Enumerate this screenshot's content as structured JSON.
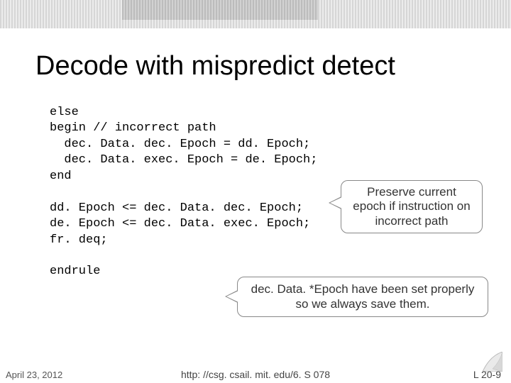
{
  "title": "Decode with mispredict detect",
  "code": "else\nbegin // incorrect path\n  dec. Data. dec. Epoch = dd. Epoch;\n  dec. Data. exec. Epoch = de. Epoch;\nend\n\ndd. Epoch <= dec. Data. dec. Epoch;\nde. Epoch <= dec. Data. exec. Epoch;\nfr. deq;\n\nendrule",
  "callouts": {
    "preserve": "Preserve current epoch if instruction on incorrect path",
    "save": "dec. Data. *Epoch have been set properly so we always save them."
  },
  "footer": {
    "date": "April 23, 2012",
    "center": "http: //csg. csail. mit. edu/6. S 078",
    "pagenum": "L 20-9"
  }
}
